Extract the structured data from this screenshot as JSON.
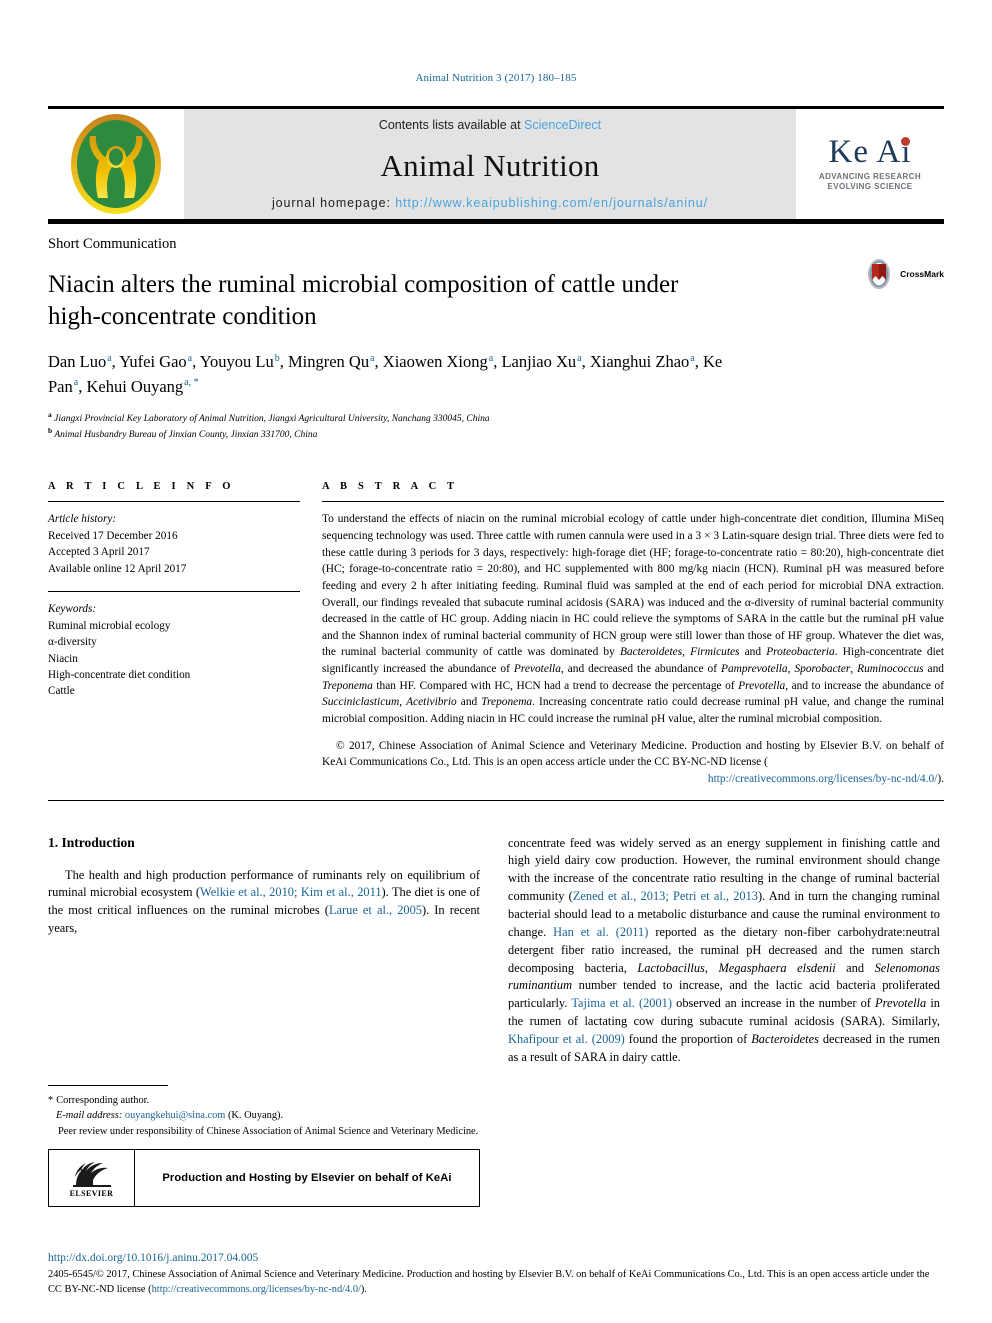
{
  "running_head": "Animal Nutrition 3 (2017) 180–185",
  "masthead": {
    "journal_logo_name": "animal-nutrition-logo",
    "contents_prefix": "Contents lists available at ",
    "contents_link": "ScienceDirect",
    "journal_name": "Animal Nutrition",
    "homepage_prefix": "journal homepage: ",
    "homepage_url": "http://www.keaipublishing.com/en/journals/aninu/",
    "keai": {
      "word": "Ke Ai",
      "tagline_line1": "ADVANCING RESEARCH",
      "tagline_line2": "EVOLVING SCIENCE"
    }
  },
  "article": {
    "section_type": "Short Communication",
    "title": "Niacin alters the ruminal microbial composition of cattle under high-concentrate condition",
    "crossmark_label": "CrossMark",
    "authors": [
      {
        "name": "Dan Luo",
        "sup": "a",
        "sep": ", "
      },
      {
        "name": "Yufei Gao",
        "sup": "a",
        "sep": ", "
      },
      {
        "name": "Youyou Lu",
        "sup": "b",
        "sep": ", "
      },
      {
        "name": "Mingren Qu",
        "sup": "a",
        "sep": ", "
      },
      {
        "name": "Xiaowen Xiong",
        "sup": "a",
        "sep": ", "
      },
      {
        "name": "Lanjiao Xu",
        "sup": "a",
        "sep": ", "
      },
      {
        "name": "Xianghui Zhao",
        "sup": "a",
        "sep": ", "
      },
      {
        "name": "Ke Pan",
        "sup": "a",
        "sep": ", "
      },
      {
        "name": "Kehui Ouyang",
        "sup": "a, *",
        "sep": ""
      }
    ],
    "affiliations": [
      {
        "mark": "a",
        "text": "Jiangxi Provincial Key Laboratory of Animal Nutrition, Jiangxi Agricultural University, Nanchang 330045, China"
      },
      {
        "mark": "b",
        "text": "Animal Husbandry Bureau of Jinxian County, Jinxian 331700, China"
      }
    ]
  },
  "article_info": {
    "heading": "A R T I C L E   I N F O",
    "history_label": "Article history:",
    "history": [
      "Received 17 December 2016",
      "Accepted 3 April 2017",
      "Available online 12 April 2017"
    ],
    "keywords_label": "Keywords:",
    "keywords": [
      "Ruminal microbial ecology",
      "α-diversity",
      "Niacin",
      "High-concentrate diet condition",
      "Cattle"
    ]
  },
  "abstract": {
    "heading": "A B S T R A C T",
    "paragraph_1": "To understand the effects of niacin on the ruminal microbial ecology of cattle under high-concentrate diet condition, Illumina MiSeq sequencing technology was used. Three cattle with rumen cannula were used in a 3 × 3 Latin-square design trial. Three diets were fed to these cattle during 3 periods for 3 days, respectively: high-forage diet (HF; forage-to-concentrate ratio = 80:20), high-concentrate diet (HC; forage-to-concentrate ratio = 20:80), and HC supplemented with 800 mg/kg niacin (HCN). Ruminal pH was measured before feeding and every 2 h after initiating feeding. Ruminal fluid was sampled at the end of each period for microbial DNA extraction. Overall, our findings revealed that subacute ruminal acidosis (SARA) was induced and the α-diversity of ruminal bacterial community decreased in the cattle of HC group. Adding niacin in HC could relieve the symptoms of SARA in the cattle but the ruminal pH value and the Shannon index of ruminal bacterial community of HCN group were still lower than those of HF group. Whatever the diet was, the ruminal bacterial community of cattle was dominated by Bacteroidetes, Firmicutes and Proteobacteria. High-concentrate diet significantly increased the abundance of Prevotella, and decreased the abundance of Pamprevotella, Sporobacter, Ruminococcus and Treponema than HF. Compared with HC, HCN had a trend to decrease the percentage of Prevotella, and to increase the abundance of Succiniclasticum, Acetivibrio and Treponema. Increasing concentrate ratio could decrease ruminal pH value, and change the ruminal microbial composition. Adding niacin in HC could increase the ruminal pH value, alter the ruminal microbial composition.",
    "copyright_text": "© 2017, Chinese Association of Animal Science and Veterinary Medicine. Production and hosting by Elsevier B.V. on behalf of KeAi Communications Co., Ltd. This is an open access article under the CC BY-NC-ND license (",
    "copyright_link": "http://creativecommons.org/licenses/by-nc-nd/4.0/",
    "copyright_tail": ")."
  },
  "introduction": {
    "heading": "1.  Introduction",
    "left_paragraph": "The health and high production performance of ruminants rely on equilibrium of ruminal microbial ecosystem (Welkie et al., 2010; Kim et al., 2011). The diet is one of the most critical influences on the ruminal microbes (Larue et al., 2005). In recent years,",
    "left_citations": [
      "Welkie et al., 2010;",
      "Kim et al., 2011",
      "Larue et al., 2005"
    ],
    "right_paragraph": "concentrate feed was widely served as an energy supplement in finishing cattle and high yield dairy cow production. However, the ruminal environment should change with the increase of the concentrate ratio resulting in the change of ruminal bacterial community (Zened et al., 2013; Petri et al., 2013). And in turn the changing ruminal bacterial should lead to a metabolic disturbance and cause the ruminal environment to change. Han et al. (2011) reported as the dietary non-fiber carbohydrate:neutral detergent fiber ratio increased, the ruminal pH decreased and the rumen starch decomposing bacteria, Lactobacillus, Megasphaera elsdenii and Selenomonas ruminantium number tended to increase, and the lactic acid bacteria proliferated particularly. Tajima et al. (2001) observed an increase in the number of Prevotella in the rumen of lactating cow during subacute ruminal acidosis (SARA). Similarly, Khafipour et al. (2009) found the proportion of Bacteroidetes decreased in the rumen as a result of SARA in dairy cattle."
  },
  "footnote": {
    "corresponding_label": "Corresponding author.",
    "email_label": "E-mail address:",
    "email": "ouyangkehui@sina.com",
    "email_owner": "(K. Ouyang).",
    "peer_review": "Peer review under responsibility of Chinese Association of Animal Science and Veterinary Medicine.",
    "elsevier_word": "ELSEVIER",
    "production_hosting": "Production and Hosting by Elsevier on behalf of KeAi"
  },
  "page_footer": {
    "doi": "http://dx.doi.org/10.1016/j.aninu.2017.04.005",
    "legal_text": "2405-6545/© 2017, Chinese Association of Animal Science and Veterinary Medicine. Production and hosting by Elsevier B.V. on behalf of KeAi Communications Co., Ltd. This is an open access article under the CC BY-NC-ND license (",
    "legal_link": "http://creativecommons.org/licenses/by-nc-nd/4.0/",
    "legal_tail": ")."
  },
  "colors": {
    "link": "#1a6496",
    "masthead_bg": "#e3e3e3",
    "sciencedirect": "#4aa3df",
    "keai_navy": "#1f3b5c",
    "keai_red": "#c0392b",
    "logo_green": "#2d8a3e",
    "logo_gold": "#f2c200"
  }
}
